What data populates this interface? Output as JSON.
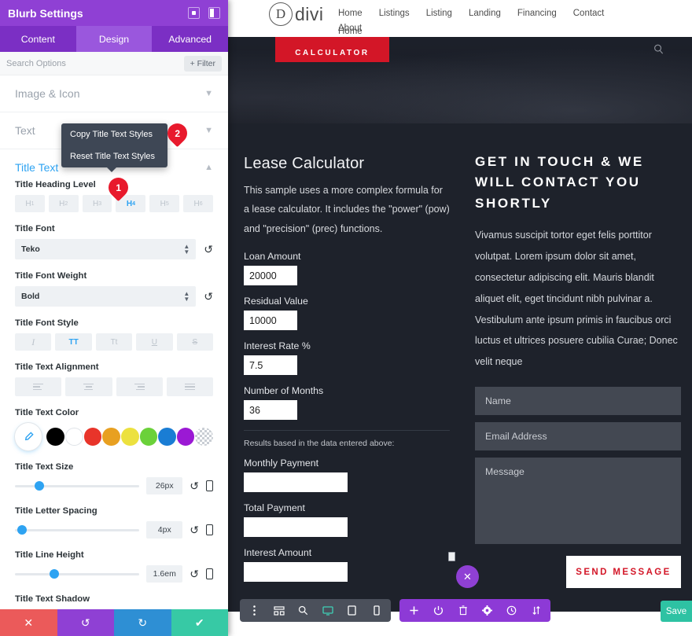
{
  "panel": {
    "title": "Blurb Settings",
    "header_icons": [
      "target-icon",
      "layout-icon"
    ],
    "tabs": [
      {
        "label": "Content",
        "active": false
      },
      {
        "label": "Design",
        "active": true
      },
      {
        "label": "Advanced",
        "active": false
      }
    ],
    "search": {
      "placeholder": "Search Options",
      "value": ""
    },
    "filter_label": "Filter",
    "accordions": [
      {
        "label": "Image & Icon",
        "open": false
      },
      {
        "label": "Text",
        "open": false
      },
      {
        "label": "Title Text",
        "open": true
      }
    ],
    "fields": {
      "heading_level": {
        "label": "Title Heading Level",
        "options": [
          "H1",
          "H2",
          "H3",
          "H4",
          "H5",
          "H6"
        ],
        "selected": "H4"
      },
      "title_font": {
        "label": "Title Font",
        "value": "Teko"
      },
      "title_font_weight": {
        "label": "Title Font Weight",
        "value": "Bold"
      },
      "title_font_style": {
        "label": "Title Font Style",
        "options": [
          "I",
          "TT",
          "Tt",
          "U",
          "S"
        ],
        "selected": "TT"
      },
      "title_text_alignment": {
        "label": "Title Text Alignment",
        "options": [
          "left",
          "center",
          "right",
          "justify"
        ],
        "selected": ""
      },
      "title_text_color": {
        "label": "Title Text Color",
        "picker": "eyedropper-icon",
        "swatches": [
          "#000000",
          "#ffffff",
          "#e8342a",
          "#e8a021",
          "#ece13f",
          "#6bd13a",
          "#1a7dd4",
          "#9b19d4",
          "transparent"
        ]
      },
      "title_text_size": {
        "label": "Title Text Size",
        "value": "26px",
        "knob_pct": 16
      },
      "title_letter_spacing": {
        "label": "Title Letter Spacing",
        "value": "4px",
        "knob_pct": 3
      },
      "title_line_height": {
        "label": "Title Line Height",
        "value": "1.6em",
        "knob_pct": 28
      },
      "title_text_shadow": {
        "label": "Title Text Shadow",
        "options": [
          "none",
          "shadow-a",
          "shadow-b"
        ]
      }
    },
    "footer_buttons": [
      {
        "name": "cancel",
        "glyph": "✕",
        "color": "#eb5a5a"
      },
      {
        "name": "undo",
        "glyph": "↺",
        "color": "#8f40d4"
      },
      {
        "name": "redo",
        "glyph": "↻",
        "color": "#2e8fd4"
      },
      {
        "name": "save",
        "glyph": "✔",
        "color": "#37c9a5"
      }
    ]
  },
  "context_menu": {
    "items": [
      "Copy Title Text Styles",
      "Reset Title Text Styles"
    ]
  },
  "callouts": [
    {
      "number": "1",
      "target": "title-heading-level"
    },
    {
      "number": "2",
      "target": "copy-title-text-styles"
    }
  ],
  "site": {
    "logo": {
      "mark": "D",
      "wordmark": "divi"
    },
    "nav_primary": [
      "Home",
      "Listings",
      "Listing",
      "Landing",
      "Financing",
      "Contact",
      "About"
    ],
    "nav_secondary": [
      "Home"
    ],
    "hero": {
      "badge": "CALCULATOR",
      "search_icon": "search-icon"
    },
    "calculator": {
      "title": "Lease Calculator",
      "description": "This sample uses a more complex formula for a lease calculator. It includes the \"power\" (pow) and \"precision\" (prec) functions.",
      "inputs": [
        {
          "label": "Loan Amount",
          "value": "20000"
        },
        {
          "label": "Residual Value",
          "value": "10000"
        },
        {
          "label": "Interest Rate %",
          "value": "7.5"
        },
        {
          "label": "Number of Months",
          "value": "36"
        }
      ],
      "results_note": "Results based in the data entered above:",
      "results": [
        {
          "label": "Monthly Payment",
          "value": ""
        },
        {
          "label": "Total Payment",
          "value": ""
        },
        {
          "label": "Interest Amount",
          "value": ""
        }
      ]
    },
    "contact": {
      "title": "GET IN TOUCH & WE WILL CONTACT YOU SHORTLY",
      "body": "Vivamus suscipit tortor eget felis porttitor volutpat. Lorem ipsum dolor sit amet, consectetur adipiscing elit. Mauris blandit aliquet elit, eget tincidunt nibh pulvinar a. Vestibulum ante ipsum primis in faucibus orci luctus et ultrices posuere cubilia Curae; Donec velit neque",
      "fields": [
        {
          "placeholder": "Name",
          "value": ""
        },
        {
          "placeholder": "Email Address",
          "value": ""
        },
        {
          "placeholder": "Message",
          "value": ""
        }
      ],
      "submit_label": "SEND MESSAGE"
    },
    "fab_close": "✕",
    "toolbar_gray": [
      "more-vertical-icon",
      "wireframe-icon",
      "zoom-icon",
      "desktop-icon",
      "tablet-icon",
      "phone-icon"
    ],
    "toolbar_gray_active": "desktop-icon",
    "toolbar_purple": [
      "plus-icon",
      "power-icon",
      "trash-icon",
      "gear-icon",
      "history-icon",
      "sort-icon"
    ],
    "save_label": "Save"
  }
}
